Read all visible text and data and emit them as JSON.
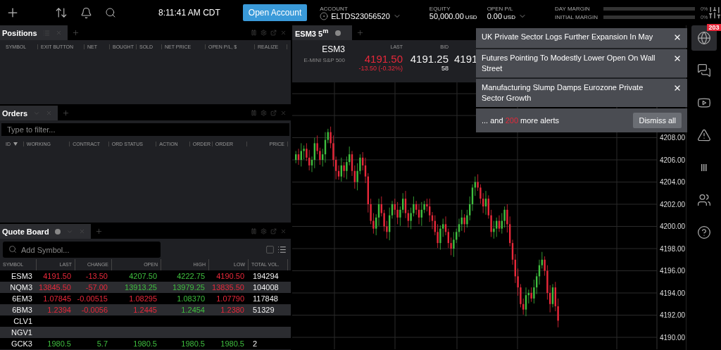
{
  "top_bar": {
    "time": "8:11:41 AM CDT",
    "open_account": "Open Account",
    "account": {
      "label": "ACCOUNT",
      "value": "ELTDS23056520"
    },
    "equity": {
      "label": "EQUITY",
      "value": "50,000.00",
      "unit": "USD"
    },
    "open_pl": {
      "label": "OPEN P/L",
      "value": "0.00",
      "unit": "USD"
    },
    "margins": [
      {
        "label": "DAY MARGIN",
        "level": 0,
        "reading": "0%"
      },
      {
        "label": "INITIAL MARGIN",
        "level": 0,
        "reading": "0%"
      }
    ]
  },
  "positions": {
    "title": "Positions",
    "columns": [
      "SYMBOL",
      "EXIT BUTTON",
      "NET",
      "BOUGHT",
      "SOLD",
      "NET PRICE",
      "OPEN P/L, $",
      "REALIZE"
    ]
  },
  "orders": {
    "title": "Orders",
    "filter": {
      "placeholder": "Type to filter..."
    },
    "columns": [
      {
        "label": "ID",
        "sorted": true
      },
      {
        "label": "WORKING",
        "sorted": false
      },
      {
        "label": "CONTRACT",
        "sorted": false
      },
      {
        "label": "ORD STATUS",
        "sorted": false
      },
      {
        "label": "ACTION",
        "sorted": false
      },
      {
        "label": "ORDER",
        "sorted": false
      },
      {
        "label": "ORDER",
        "sorted": false
      },
      {
        "label": "PRICE",
        "sorted": false
      }
    ]
  },
  "quote_board": {
    "title": "Quote Board",
    "search": {
      "placeholder": "Add Symbol..."
    },
    "columns": [
      "SYMBOL",
      "LAST",
      "CHANGE",
      "OPEN",
      "HIGH",
      "LOW",
      "TOTAL VOL."
    ],
    "rows": [
      {
        "cells": [
          {
            "text": "ESM3"
          },
          {
            "text": "4191.50",
            "negative": true
          },
          {
            "text": "-13.50",
            "negative": true
          },
          {
            "text": "4207.50",
            "negative": false
          },
          {
            "text": "4222.75",
            "negative": false
          },
          {
            "text": "4190.50",
            "negative": true
          },
          {
            "text": "194294"
          }
        ]
      },
      {
        "cells": [
          {
            "text": "NQM3"
          },
          {
            "text": "13845.50",
            "negative": true
          },
          {
            "text": "-57.00",
            "negative": true
          },
          {
            "text": "13913.25",
            "negative": false
          },
          {
            "text": "13979.25",
            "negative": false
          },
          {
            "text": "13835.50",
            "negative": true
          },
          {
            "text": "104008"
          }
        ]
      },
      {
        "cells": [
          {
            "text": "6EM3"
          },
          {
            "text": "1.07845",
            "negative": true
          },
          {
            "text": "-0.00515",
            "negative": true
          },
          {
            "text": "1.08295",
            "negative": true
          },
          {
            "text": "1.08370",
            "negative": false
          },
          {
            "text": "1.07790",
            "negative": true
          },
          {
            "text": "117848"
          }
        ]
      },
      {
        "cells": [
          {
            "text": "6BM3"
          },
          {
            "text": "1.2394",
            "negative": true
          },
          {
            "text": "-0.0056",
            "negative": true
          },
          {
            "text": "1.2445",
            "negative": true
          },
          {
            "text": "1.2454",
            "negative": false
          },
          {
            "text": "1.2380",
            "negative": true
          },
          {
            "text": "51329"
          }
        ]
      },
      {
        "cells": [
          {
            "text": "CLV1"
          }
        ]
      },
      {
        "cells": [
          {
            "text": "NGV1"
          }
        ]
      },
      {
        "cells": [
          {
            "text": "GCK3"
          },
          {
            "text": "1980.5",
            "negative": false
          },
          {
            "text": "5.7",
            "negative": false
          },
          {
            "text": "1980.5",
            "negative": false
          },
          {
            "text": "1980.5",
            "negative": false
          },
          {
            "text": "1980.5",
            "negative": false
          },
          {
            "text": "2"
          }
        ]
      }
    ]
  },
  "chart_panel": {
    "tab": "ESM3 5$^{m}$",
    "symbol": "ESM3",
    "description": "E-MINI S&P 500",
    "quotes": [
      {
        "label": "LAST",
        "value": "4191.50",
        "sub": "-13.50 (-0.32%)",
        "negative": true
      },
      {
        "label": "BID",
        "value": "4191.25",
        "sub": "58"
      },
      {
        "value": "4191"
      }
    ],
    "price_axis": [
      "4208.00",
      "4206.00",
      "4204.00",
      "4202.00",
      "4200.00",
      "4198.00",
      "4196.00",
      "4194.00",
      "4192.00",
      "4190.00"
    ]
  },
  "alerts": {
    "items": [
      "UK Private Sector Logs Further Expansion In May",
      "Futures Pointing To Modestly Lower Open On Wall Street",
      "Manufacturing Slump Damps Eurozone Private Sector Growth"
    ],
    "more": {
      "prefix": "... and",
      "count": "200",
      "suffix": "more alerts"
    },
    "dismiss": "Dismiss all"
  },
  "sidebar": {
    "items": [
      {
        "kind": "news",
        "selected": true,
        "badge": "203"
      },
      {
        "kind": "chat",
        "selected": false
      },
      {
        "kind": "video",
        "selected": false
      },
      {
        "kind": "alert",
        "selected": false
      },
      {
        "kind": "bars",
        "selected": false
      },
      {
        "kind": "community",
        "selected": false
      },
      {
        "kind": "help",
        "selected": false
      }
    ]
  }
}
